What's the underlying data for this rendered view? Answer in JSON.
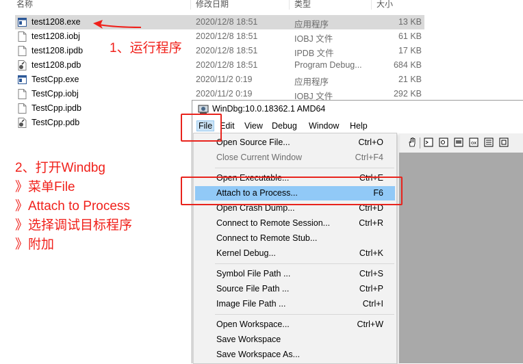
{
  "explorer": {
    "columns": {
      "name": "名称",
      "date": "修改日期",
      "type": "类型",
      "size": "大小"
    },
    "files": [
      {
        "name": "test1208.exe",
        "date": "2020/12/8 18:51",
        "type": "应用程序",
        "size": "13 KB",
        "icon": "exe-icon",
        "selected": true
      },
      {
        "name": "test1208.iobj",
        "date": "2020/12/8 18:51",
        "type": "IOBJ 文件",
        "size": "61 KB",
        "icon": "file-icon"
      },
      {
        "name": "test1208.ipdb",
        "date": "2020/12/8 18:51",
        "type": "IPDB 文件",
        "size": "17 KB",
        "icon": "file-icon"
      },
      {
        "name": "test1208.pdb",
        "date": "2020/12/8 18:51",
        "type": "Program Debug...",
        "size": "684 KB",
        "icon": "pdb-icon"
      },
      {
        "name": "TestCpp.exe",
        "date": "2020/11/2 0:19",
        "type": "应用程序",
        "size": "21 KB",
        "icon": "exe-icon"
      },
      {
        "name": "TestCpp.iobj",
        "date": "2020/11/2 0:19",
        "type": "IOBJ 文件",
        "size": "292 KB",
        "icon": "file-icon"
      },
      {
        "name": "TestCpp.ipdb",
        "date": "",
        "type": "",
        "size": "",
        "icon": "file-icon"
      },
      {
        "name": "TestCpp.pdb",
        "date": "",
        "type": "",
        "size": "",
        "icon": "pdb-icon"
      }
    ]
  },
  "annotations": {
    "step1": "1、运行程序",
    "step2": [
      "2、打开Windbg",
      "》菜单File",
      "》Attach to Process",
      "》选择调试目标程序",
      "》附加"
    ]
  },
  "colors": {
    "annotation": "#f0201a",
    "highlight": "#91c9f7",
    "selected_row": "#d9d9d9"
  },
  "windbg": {
    "title": "WinDbg:10.0.18362.1 AMD64",
    "menu": [
      "File",
      "Edit",
      "View",
      "Debug",
      "Window",
      "Help"
    ],
    "active_menu": "File",
    "file_menu": [
      {
        "label": "Open Source File...",
        "shortcut": "Ctrl+O"
      },
      {
        "label": "Close Current Window",
        "shortcut": "Ctrl+F4",
        "disabled": true
      },
      {
        "separator": true
      },
      {
        "label": "Open Executable...",
        "shortcut": "Ctrl+E"
      },
      {
        "label": "Attach to a Process...",
        "shortcut": "F6",
        "highlighted": true
      },
      {
        "label": "Open Crash Dump...",
        "shortcut": "Ctrl+D"
      },
      {
        "label": "Connect to Remote Session...",
        "shortcut": "Ctrl+R"
      },
      {
        "label": "Connect to Remote Stub...",
        "shortcut": ""
      },
      {
        "label": "Kernel Debug...",
        "shortcut": "Ctrl+K"
      },
      {
        "separator": true
      },
      {
        "label": "Symbol File Path ...",
        "shortcut": "Ctrl+S"
      },
      {
        "label": "Source File Path ...",
        "shortcut": "Ctrl+P"
      },
      {
        "label": "Image File Path ...",
        "shortcut": "Ctrl+I"
      },
      {
        "separator": true
      },
      {
        "label": "Open Workspace...",
        "shortcut": "Ctrl+W"
      },
      {
        "label": "Save Workspace",
        "shortcut": ""
      },
      {
        "label": "Save Workspace As...",
        "shortcut": ""
      }
    ]
  }
}
